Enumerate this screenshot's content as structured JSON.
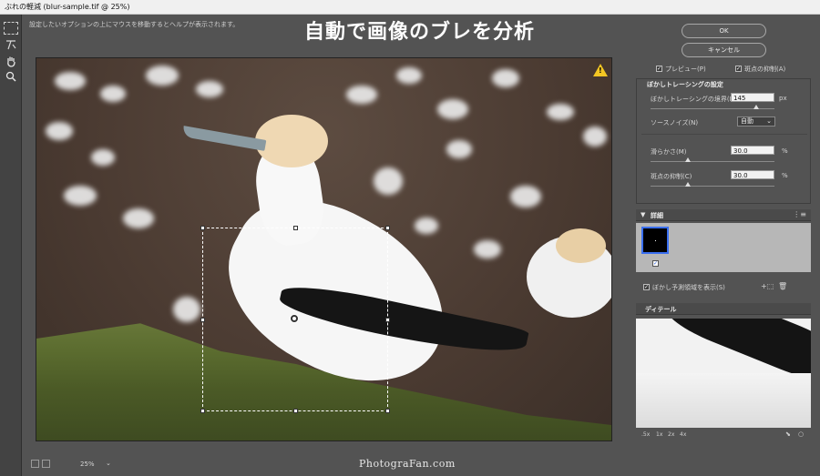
{
  "window": {
    "title": "ぶれの軽減 (blur-sample.tif @ 25%)"
  },
  "help": {
    "text": "設定したいオプションの上にマウスを移動するとヘルプが表示されます。"
  },
  "overlay": {
    "title": "自動で画像のブレを分析"
  },
  "canvas": {
    "warning_glyph": "!"
  },
  "status": {
    "zoom": "25%",
    "zoom_caret": "⌄",
    "watermark": "PhotograFan.com"
  },
  "buttons": {
    "ok": "OK",
    "cancel": "キャンセル"
  },
  "options": {
    "preview_label": "プレビュー(P)",
    "preview_checked": true,
    "artifact_label": "斑点の抑制(A)",
    "artifact_checked": true
  },
  "blur_trace": {
    "section_title": "ぼかしトレーシングの設定",
    "bounds_label": "ぼかしトレーシングの境界(B)",
    "bounds_value": "145",
    "bounds_unit": "px",
    "bounds_level": 0.85,
    "noise_label": "ソースノイズ(N)",
    "noise_value": "自動",
    "smoothing_label": "滑らかさ(M)",
    "smoothing_value": "30.0",
    "smoothing_unit": "%",
    "smoothing_level": 0.3,
    "artifact_supp_label": "斑点の抑制(C)",
    "artifact_supp_value": "30.0",
    "artifact_supp_unit": "%",
    "artifact_supp_level": 0.3
  },
  "advanced": {
    "title": "詳細",
    "show_estimation_label": "ぼかし予測領域を表示(S)",
    "show_estimation_checked": true
  },
  "detail": {
    "title": "ディテール",
    "zoom_levels": [
      ".5x",
      "1x",
      "2x",
      "4x"
    ]
  },
  "icons": {
    "tool1": "marquee-icon",
    "tool2": "blur-trace-icon",
    "tool3": "hand-icon",
    "tool4": "zoom-icon"
  },
  "colors": {
    "accent": "#3a6ff0",
    "warning": "#f3c623"
  }
}
